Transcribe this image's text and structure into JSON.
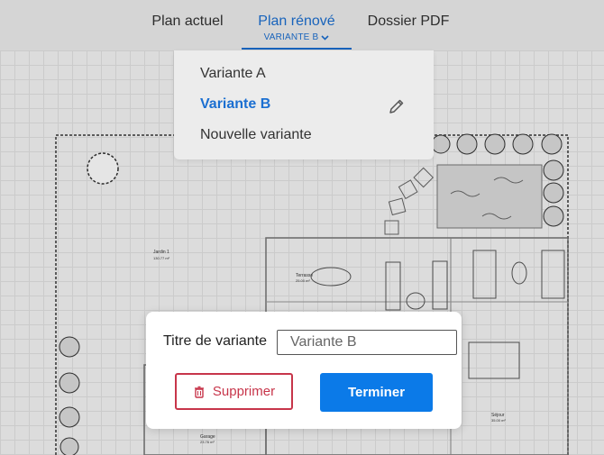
{
  "tabs": [
    {
      "label": "Plan actuel"
    },
    {
      "label": "Plan rénové",
      "sublabel": "VARIANTE B",
      "active": true
    },
    {
      "label": "Dossier PDF"
    }
  ],
  "dropdown": {
    "items": [
      {
        "label": "Variante A"
      },
      {
        "label": "Variante B",
        "selected": true
      },
      {
        "label": "Nouvelle variante"
      }
    ]
  },
  "plan_labels": {
    "jardin": "Jardin 1",
    "jardin_area": "130.77 m²",
    "terrasse": "Terrasse",
    "terrasse_area": "25.00 m²",
    "garage": "Garage",
    "garage_area": "23.76 m²",
    "salon": "Séjour",
    "salon_area": "35.00 m²"
  },
  "dialog": {
    "title_label": "Titre de variante",
    "title_value": "Variante B",
    "delete_label": "Supprimer",
    "finish_label": "Terminer"
  },
  "colors": {
    "accent": "#1b6fd1",
    "primary_button": "#0b7ae8",
    "danger": "#c7354a"
  }
}
